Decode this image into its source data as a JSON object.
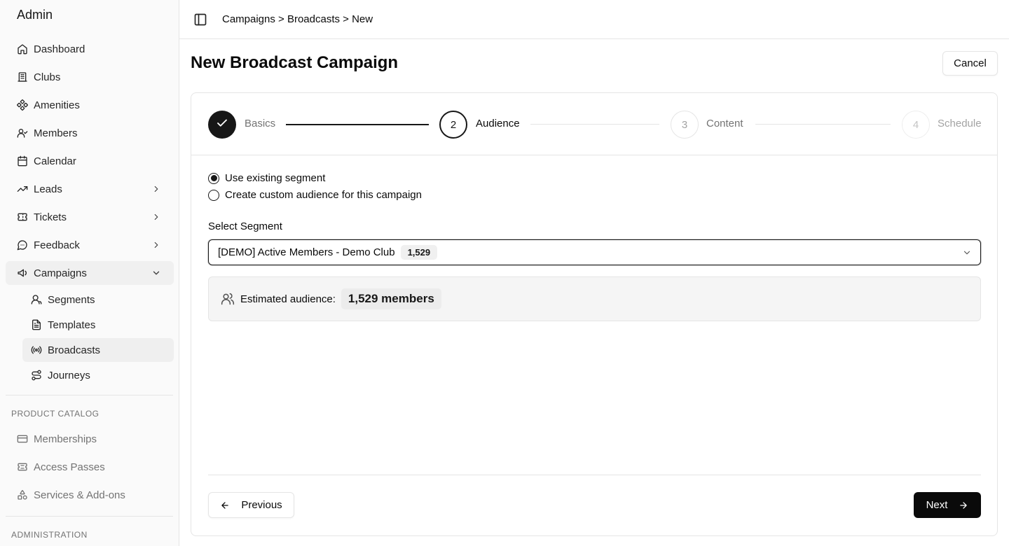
{
  "sidebar": {
    "brand": "Admin",
    "nav": [
      {
        "label": "Dashboard",
        "icon": "home-icon"
      },
      {
        "label": "Clubs",
        "icon": "building-icon"
      },
      {
        "label": "Amenities",
        "icon": "amenities-icon"
      },
      {
        "label": "Members",
        "icon": "members-icon"
      },
      {
        "label": "Calendar",
        "icon": "calendar-icon"
      },
      {
        "label": "Leads",
        "icon": "trending-up-icon"
      },
      {
        "label": "Tickets",
        "icon": "ticket-icon"
      },
      {
        "label": "Feedback",
        "icon": "message-icon"
      },
      {
        "label": "Campaigns",
        "icon": "megaphone-icon"
      }
    ],
    "campaigns_sub": [
      {
        "label": "Segments",
        "icon": "user-icon"
      },
      {
        "label": "Templates",
        "icon": "file-text-icon"
      },
      {
        "label": "Broadcasts",
        "icon": "radio-broadcast-icon"
      },
      {
        "label": "Journeys",
        "icon": "route-icon"
      }
    ],
    "product_catalog_label": "PRODUCT CATALOG",
    "product_catalog": [
      {
        "label": "Memberships",
        "icon": "card-icon"
      },
      {
        "label": "Access Passes",
        "icon": "ticket-pass-icon"
      },
      {
        "label": "Services & Add-ons",
        "icon": "shapes-icon"
      }
    ],
    "administration_label": "ADMINISTRATION"
  },
  "header": {
    "breadcrumb": "Campaigns > Broadcasts > New"
  },
  "main": {
    "title": "New Broadcast Campaign",
    "cancel_label": "Cancel",
    "steps": [
      {
        "number": "",
        "label": "Basics",
        "state": "complete"
      },
      {
        "number": "2",
        "label": "Audience",
        "state": "current"
      },
      {
        "number": "3",
        "label": "Content",
        "state": "upcoming"
      },
      {
        "number": "4",
        "label": "Schedule",
        "state": "upcoming"
      }
    ],
    "audience_options": [
      {
        "label": "Use existing segment",
        "selected": true
      },
      {
        "label": "Create custom audience for this campaign",
        "selected": false
      }
    ],
    "segment_label": "Select Segment",
    "segment_value": "[DEMO] Active Members - Demo Club",
    "segment_count": "1,529",
    "estimate_label": "Estimated audience:",
    "estimate_value": "1,529 members",
    "previous_label": "Previous",
    "next_label": "Next"
  },
  "colors": {
    "primary": "#0a0a0a",
    "border": "#e5e5e5",
    "muted_text": "#737373",
    "sidebar_bg": "#fafafa"
  }
}
